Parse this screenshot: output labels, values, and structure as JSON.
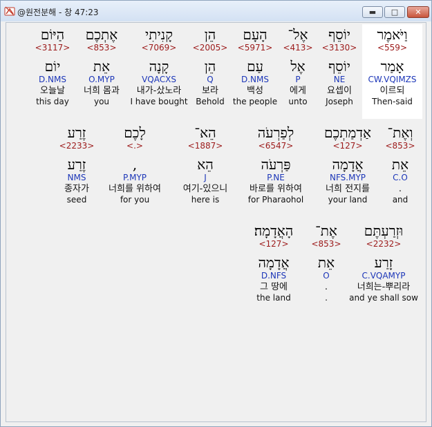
{
  "window": {
    "title": "@원전분해 - 창 47:23",
    "icon": "app-bible-icon",
    "controls": {
      "minimize": "▬",
      "maximize": "□",
      "close": "✕"
    }
  },
  "rows": [
    [
      {
        "heb": "וַיֹּאמֶר",
        "strong": "<559>",
        "lemma": "אָמַר",
        "morph": "CW.VQIMZS",
        "kor": "이르되",
        "eng": "Then-said"
      },
      {
        "heb": "יוֹסֵף",
        "strong": "<3130>",
        "lemma": "יוֹסֵף",
        "morph": "NE",
        "kor": "요셉이",
        "eng": "Joseph"
      },
      {
        "heb": "אֶל־",
        "strong": "<413>",
        "lemma": "אֶל",
        "morph": "P",
        "kor": "에게",
        "eng": "unto"
      },
      {
        "heb": "הָעָם",
        "strong": "<5971>",
        "lemma": "עַם",
        "morph": "D.NMS",
        "kor": "백성",
        "eng": "the people"
      },
      {
        "heb": "הֵן",
        "strong": "<2005>",
        "lemma": "הֵן",
        "morph": "Q",
        "kor": "보라",
        "eng": "Behold"
      },
      {
        "heb": "קָנִיתִי",
        "strong": "<7069>",
        "lemma": "קָנָה",
        "morph": "VQACXS",
        "kor": "내가-샀노라",
        "eng": "I have bought"
      },
      {
        "heb": "אֶתְכֶם",
        "strong": "<853>",
        "lemma": "אֵת",
        "morph": "O.MYP",
        "kor": "너희 몸과",
        "eng": "you"
      },
      {
        "heb": "הַיּוֹם",
        "strong": "<3117>",
        "lemma": "יוֹם",
        "morph": "D.NMS",
        "kor": "오늘날",
        "eng": "this day"
      }
    ],
    [
      {
        "heb": "וְאֶת־",
        "strong": "<853>",
        "lemma": "אֵת",
        "morph": "C.O",
        "kor": ".",
        "eng": "and"
      },
      {
        "heb": "אַדְמַתְכֶם",
        "strong": "<127>",
        "lemma": "אֲדָמָה",
        "morph": "NFS.MYP",
        "kor": "너희 전지를",
        "eng": "your land"
      },
      {
        "heb": "לְפַרְעֹה",
        "strong": "<6547>",
        "lemma": "פַּרְעֹה",
        "morph": "P.NE",
        "kor": "바로를 위하여",
        "eng": "for Pharaohol"
      },
      {
        "heb": "הֵא־",
        "strong": "<1887>",
        "lemma": "הֵא",
        "morph": "J",
        "kor": "여기-있으니",
        "eng": "here is"
      },
      {
        "heb": "לָכֶם",
        "strong": "<.>",
        "lemma": ",",
        "morph": "P.MYP",
        "kor": "너희를 위하여",
        "eng": "for you"
      },
      {
        "heb": "זֶרַע",
        "strong": "<2233>",
        "lemma": "זֶרַע",
        "morph": "NMS",
        "kor": "종자가",
        "eng": "seed"
      }
    ],
    [
      {
        "heb": "וּזְרַעְתֶּם",
        "strong": "<2232>",
        "lemma": "זָרַע",
        "morph": "C.VQAMYP",
        "kor": "너희는-뿌리라",
        "eng": "and ye shall sow"
      },
      {
        "heb": "אֶת־",
        "strong": "<853>",
        "lemma": "אֵת",
        "morph": "O",
        "kor": ".",
        "eng": "."
      },
      {
        "heb": "הָאֲדָמָה׃",
        "strong": "<127>",
        "lemma": "אֲדָמָה",
        "morph": "D.NFS",
        "kor": "그 땅에",
        "eng": "the land"
      }
    ]
  ]
}
